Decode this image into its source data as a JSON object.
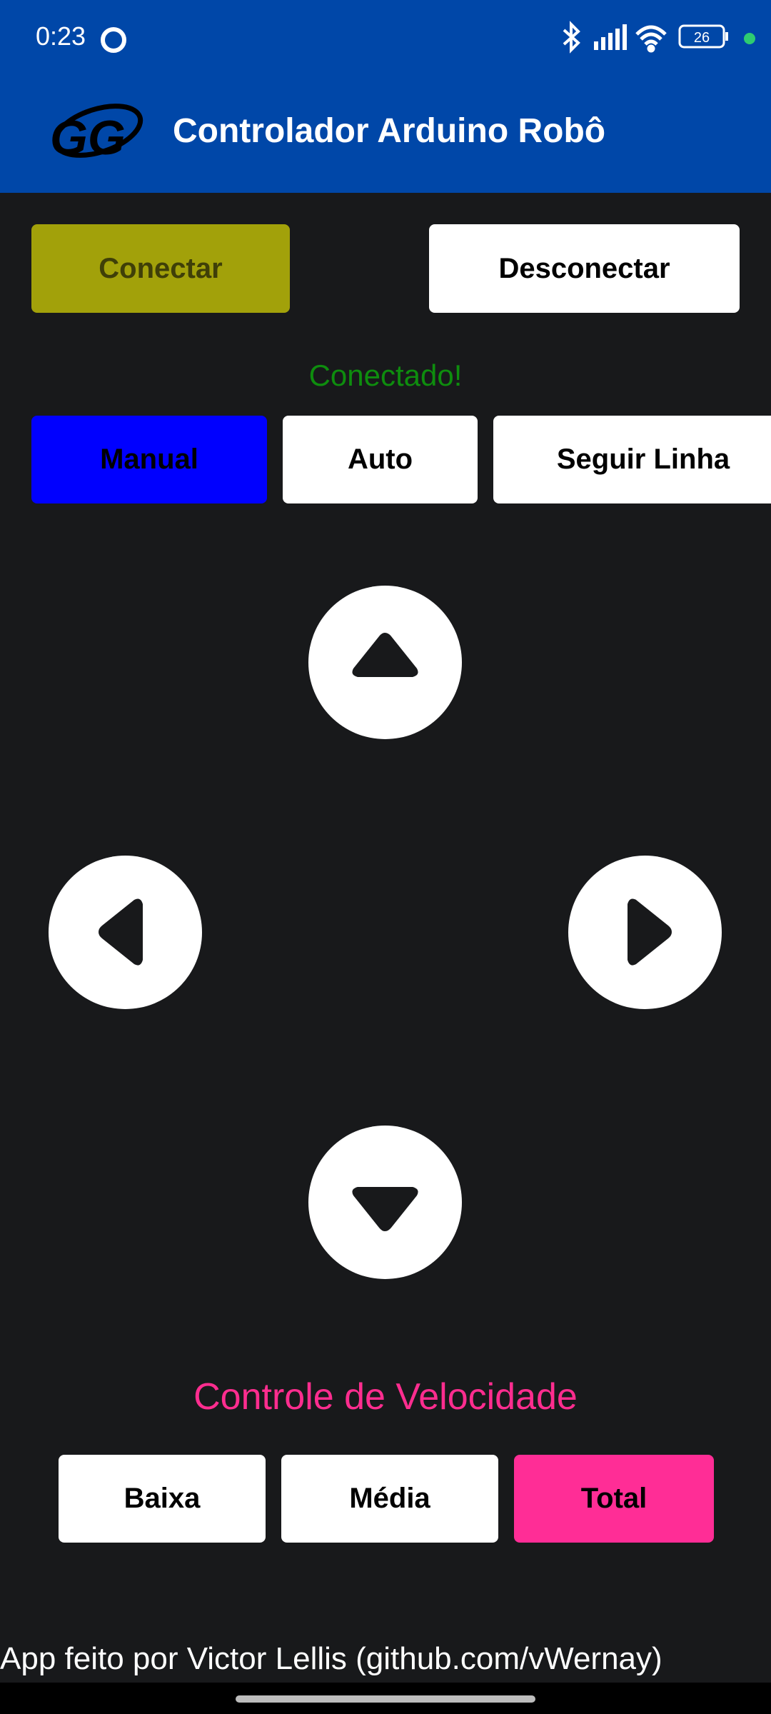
{
  "status_bar": {
    "time": "0:23",
    "battery": "26",
    "icons": [
      "circle-icon",
      "bluetooth-icon",
      "signal-icon",
      "wifi-icon",
      "battery-icon",
      "green-dot-icon"
    ]
  },
  "app_bar": {
    "title": "Controlador Arduino Robô",
    "logo_text": "GG"
  },
  "connection": {
    "connect_label": "Conectar",
    "disconnect_label": "Desconectar",
    "status": "Conectado!"
  },
  "modes": {
    "manual_label": "Manual",
    "auto_label": "Auto",
    "follow_label": "Seguir Linha"
  },
  "dpad": {
    "icons": [
      "arrow-up-icon",
      "arrow-left-icon",
      "arrow-right-icon",
      "arrow-down-icon"
    ]
  },
  "speed": {
    "title": "Controle de Velocidade",
    "low_label": "Baixa",
    "mid_label": "Média",
    "total_label": "Total"
  },
  "footer": {
    "credit": "App feito por Victor Lellis (github.com/vWernay)"
  },
  "colors": {
    "app_bar": "#0047a8",
    "background": "#18191b",
    "connect": "#a2a10a",
    "manual_active": "#0000ff",
    "status_ok": "#0e8d0e",
    "accent_pink": "#ff2d8f"
  }
}
